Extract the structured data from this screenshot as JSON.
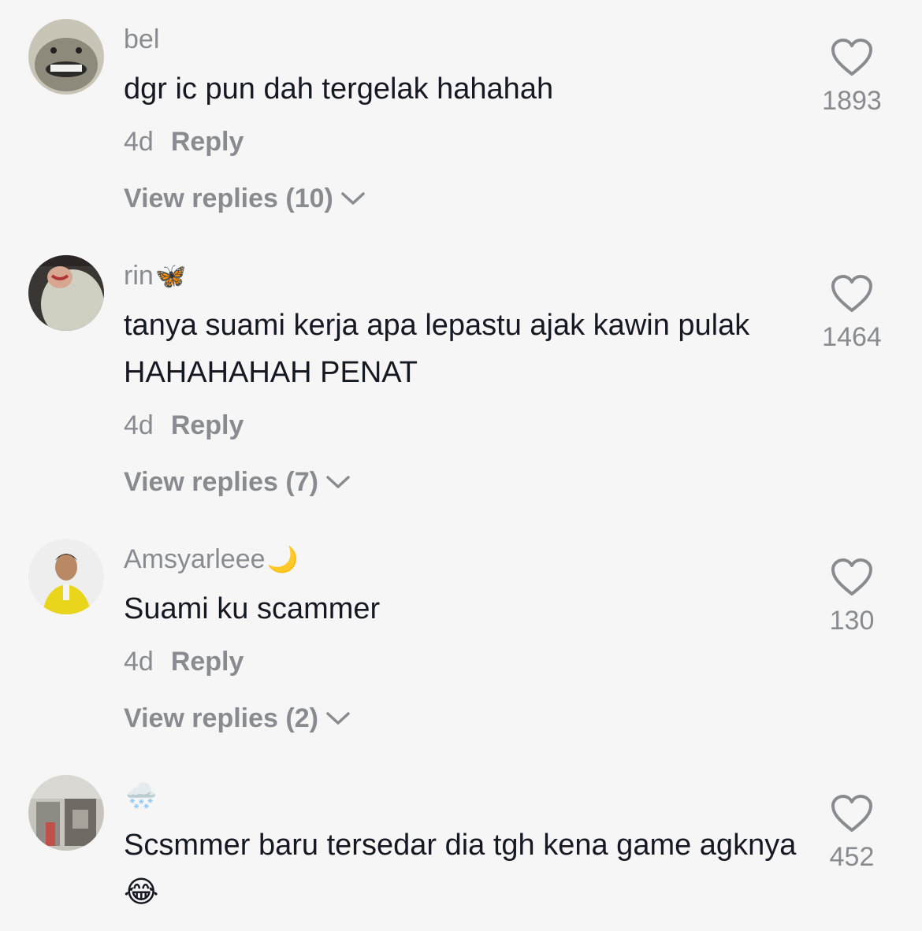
{
  "comments": [
    {
      "username": "bel",
      "username_emoji": "",
      "text": "dgr ic pun dah tergelak hahahah",
      "age": "4d",
      "reply_label": "Reply",
      "view_replies": "View replies (10)",
      "likes": "1893",
      "avatar_icon": "smiling-animal-avatar"
    },
    {
      "username": "rin",
      "username_emoji": "🦋",
      "text": "tanya suami kerja apa lepastu ajak kawin pulak HAHAHAHAH PENAT",
      "age": "4d",
      "reply_label": "Reply",
      "view_replies": "View replies (7)",
      "likes": "1464",
      "avatar_icon": "hijab-selfie-avatar"
    },
    {
      "username": "Amsyarleee",
      "username_emoji": "🌙",
      "text": "Suami ku scammer",
      "age": "4d",
      "reply_label": "Reply",
      "view_replies": "View replies (2)",
      "likes": "130",
      "avatar_icon": "man-yellow-jacket-avatar"
    },
    {
      "username": "",
      "username_emoji": "🌨️",
      "text": "Scsmmer baru tersedar dia tgh kena game agknya 😂",
      "age": "",
      "reply_label": "",
      "view_replies": "",
      "likes": "452",
      "avatar_icon": "building-photo-avatar"
    }
  ],
  "colors": {
    "background": "#f6f6f6",
    "text": "#161823",
    "muted": "#8a8b91"
  },
  "icons": {
    "like": "heart-outline-icon",
    "expand": "chevron-down-icon"
  }
}
